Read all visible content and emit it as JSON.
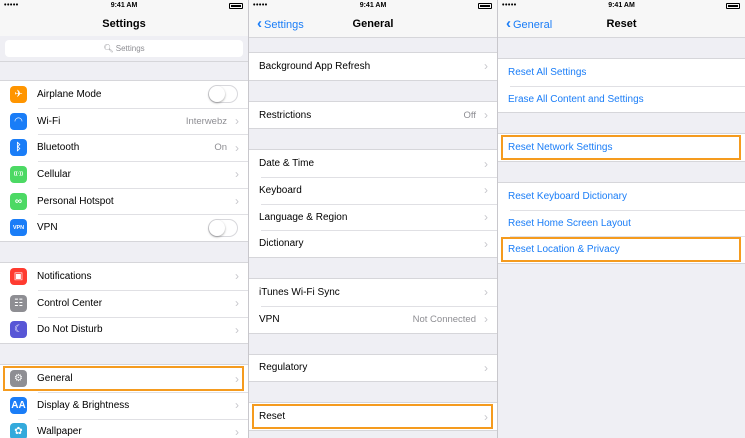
{
  "status": {
    "time": "9:41 AM",
    "carrier": "•••••"
  },
  "panel1": {
    "title": "Settings",
    "search_placeholder": "Settings",
    "groups": [
      [
        {
          "label": "Airplane Mode",
          "icon": "airplane-icon",
          "color": "#ff9500",
          "glyph": "✈",
          "toggle": true
        },
        {
          "label": "Wi-Fi",
          "icon": "wifi-icon",
          "color": "#1a7df7",
          "glyph": "◠",
          "value": "Interwebz"
        },
        {
          "label": "Bluetooth",
          "icon": "bluetooth-icon",
          "color": "#1a7df7",
          "glyph": "ᛒ",
          "value": "On"
        },
        {
          "label": "Cellular",
          "icon": "cellular-icon",
          "color": "#4cd964",
          "glyph": "((·))"
        },
        {
          "label": "Personal Hotspot",
          "icon": "hotspot-icon",
          "color": "#4cd964",
          "glyph": "∞"
        },
        {
          "label": "VPN",
          "icon": "vpn-icon",
          "color": "#1a7df7",
          "glyph": "VPN",
          "toggle": true
        }
      ],
      [
        {
          "label": "Notifications",
          "icon": "notifications-icon",
          "color": "#ff3b30",
          "glyph": "▣"
        },
        {
          "label": "Control Center",
          "icon": "control-center-icon",
          "color": "#8e8e93",
          "glyph": "☷"
        },
        {
          "label": "Do Not Disturb",
          "icon": "moon-icon",
          "color": "#5856d6",
          "glyph": "☾"
        }
      ],
      [
        {
          "label": "General",
          "icon": "gear-icon",
          "color": "#8e8e93",
          "glyph": "⚙",
          "highlight": true
        },
        {
          "label": "Display & Brightness",
          "icon": "display-icon",
          "color": "#1a7df7",
          "glyph": "AA"
        },
        {
          "label": "Wallpaper",
          "icon": "wallpaper-icon",
          "color": "#34aadc",
          "glyph": "✿"
        }
      ]
    ]
  },
  "panel2": {
    "title": "General",
    "back": "Settings",
    "groups": [
      [
        {
          "label": "Background App Refresh"
        }
      ],
      [
        {
          "label": "Restrictions",
          "value": "Off"
        }
      ],
      [
        {
          "label": "Date & Time"
        },
        {
          "label": "Keyboard"
        },
        {
          "label": "Language & Region"
        },
        {
          "label": "Dictionary"
        }
      ],
      [
        {
          "label": "iTunes Wi-Fi Sync"
        },
        {
          "label": "VPN",
          "value": "Not Connected"
        }
      ],
      [
        {
          "label": "Regulatory"
        }
      ],
      [
        {
          "label": "Reset",
          "highlight": true
        }
      ]
    ]
  },
  "panel3": {
    "title": "Reset",
    "back": "General",
    "groups": [
      [
        {
          "label": "Reset All Settings"
        },
        {
          "label": "Erase All Content and Settings"
        }
      ],
      [
        {
          "label": "Reset Network Settings",
          "highlight": true
        }
      ],
      [
        {
          "label": "Reset Keyboard Dictionary"
        },
        {
          "label": "Reset Home Screen Layout"
        },
        {
          "label": "Reset Location & Privacy",
          "highlight": true
        }
      ]
    ]
  },
  "colors": {
    "accent": "#1a7df7",
    "highlight": "#f59b1e"
  }
}
